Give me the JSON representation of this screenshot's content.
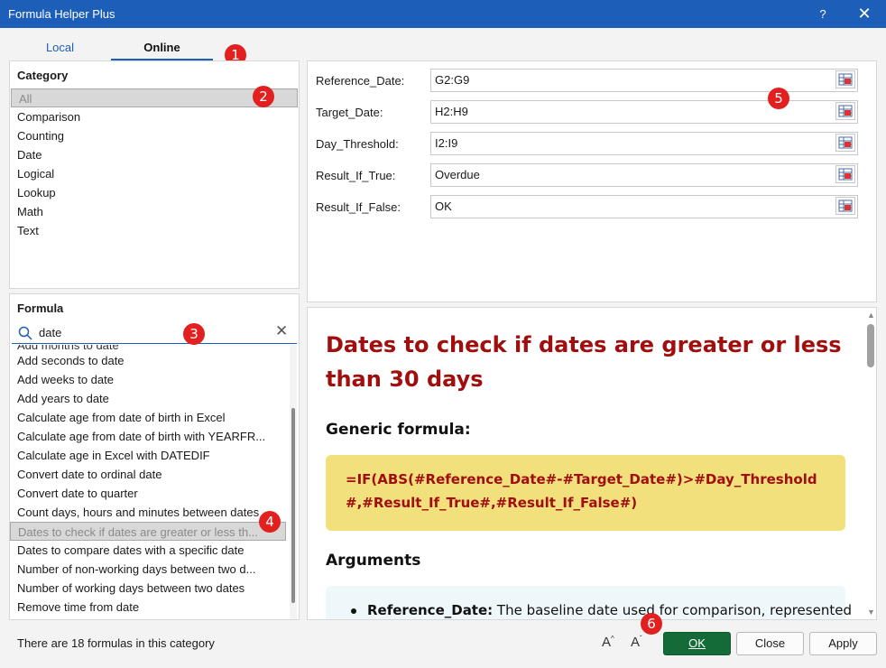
{
  "window": {
    "title": "Formula Helper Plus",
    "help_label": "?",
    "close_label": "✕"
  },
  "tabs": [
    {
      "label": "Local"
    },
    {
      "label": "Online"
    }
  ],
  "badges": [
    "1",
    "2",
    "3",
    "4",
    "5",
    "6"
  ],
  "category": {
    "header": "Category",
    "items": [
      "All",
      "Comparison",
      "Counting",
      "Date",
      "Logical",
      "Lookup",
      "Math",
      "Text"
    ],
    "selected": "All"
  },
  "formula": {
    "header": "Formula",
    "search_value": "date",
    "items": [
      "Add months to date",
      "Add seconds to date",
      "Add weeks to date",
      "Add years to date",
      "Calculate age from date of birth in Excel",
      "Calculate age from date of birth with YEARFR...",
      "Calculate age in Excel with DATEDIF",
      "Convert date to ordinal date",
      "Convert date to quarter",
      "Count days, hours and minutes between dates",
      "Dates to check if dates are greater or less th...",
      "Dates to compare dates with a specific date",
      "Number of non-working days between two d...",
      "Number of working days between two dates",
      "Remove time from date"
    ],
    "selected": "Dates to check if dates are greater or less th..."
  },
  "arguments": [
    {
      "label": "Reference_Date:",
      "value": "G2:G9"
    },
    {
      "label": "Target_Date:",
      "value": "H2:H9"
    },
    {
      "label": "Day_Threshold:",
      "value": "I2:I9"
    },
    {
      "label": "Result_If_True:",
      "value": "Overdue"
    },
    {
      "label": "Result_If_False:",
      "value": "OK"
    }
  ],
  "doc": {
    "title": "Dates to check if dates are greater or less than 30 days",
    "generic_heading": "Generic formula:",
    "formula_text": "=IF(ABS(#Reference_Date#-#Target_Date#)>#Day_Threshold#,#Result_If_True#,#Result_If_False#)",
    "arguments_heading": "Arguments",
    "arg1_name": "Reference_Date:",
    "arg1_desc": " The baseline date used for comparison, represented"
  },
  "footer": {
    "status": "There are 18 formulas in this category",
    "font_up": "A",
    "font_down": "A",
    "ok_label": "OK",
    "close_label": "Close",
    "apply_label": "Apply"
  },
  "colors": {
    "accent": "#1d5fb8",
    "ok_button": "#156b37",
    "doc_title": "#a00e0e",
    "formula_bg": "#f2e07d",
    "badge": "#e32020"
  }
}
